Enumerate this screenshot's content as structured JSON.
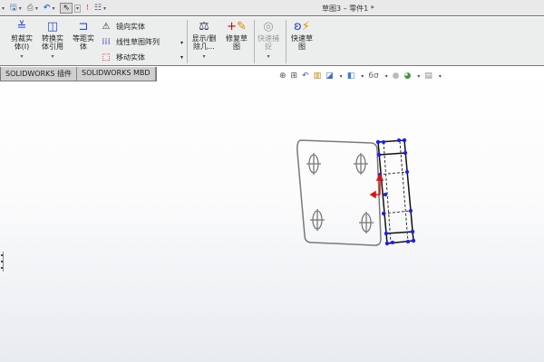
{
  "window": {
    "title": "草图3 – 零件1 *"
  },
  "quick_access": [
    {
      "icon": "save-icon"
    },
    {
      "icon": "print-icon"
    },
    {
      "icon": "undo-icon"
    },
    {
      "icon": "select-pointer-icon"
    },
    {
      "icon": "rebuild-traffic-light-icon"
    },
    {
      "icon": "options-list-icon"
    }
  ],
  "ribbon": {
    "trim": "剪裁实体(I)",
    "convert": "转换实体引用",
    "offset": "等距实体",
    "mirror": "镜向实体",
    "linear_pattern": "线性草图阵列",
    "move": "移动实体",
    "display_delete": "显示/删除几...",
    "repair": "修复草图",
    "quick_snap": "快速捕捉",
    "rapid_sketch": "快速草图"
  },
  "tabs": [
    {
      "label": "SOLIDWORKS 插件"
    },
    {
      "label": "SOLIDWORKS MBD"
    }
  ],
  "colors": {
    "sketch_gray": "#7a7a7a",
    "sketch_blue": "#1a1aff",
    "sketch_black": "#111111",
    "origin_red": "#e01010"
  }
}
